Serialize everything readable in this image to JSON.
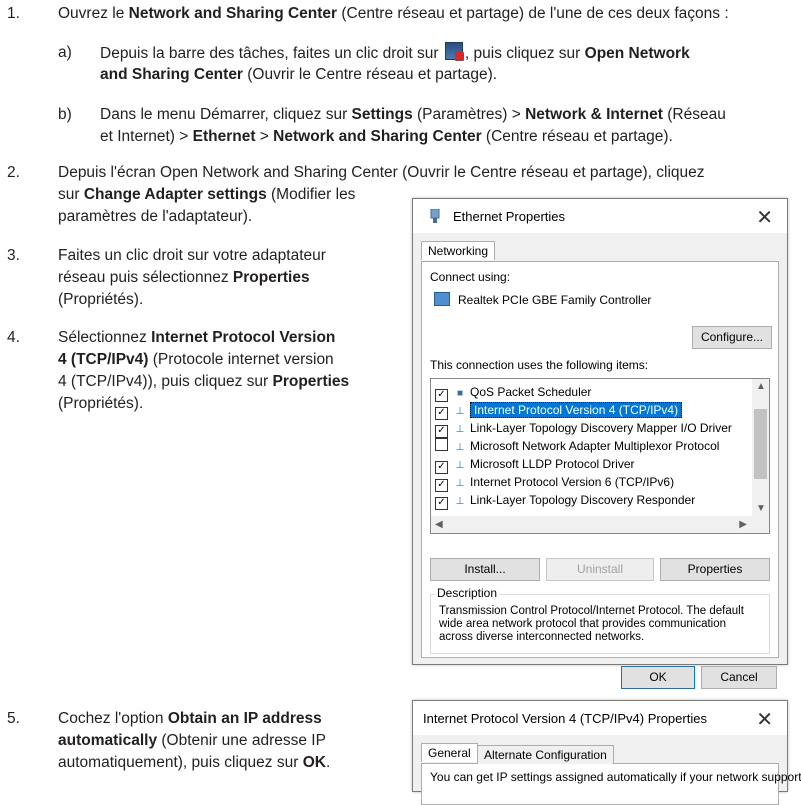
{
  "steps": {
    "s1": {
      "num": "1.",
      "t1": "Ouvrez le ",
      "b1": "Network and Sharing Center",
      "t2": " (Centre réseau et partage) de l'une de ces deux façons :",
      "a": {
        "label": "a)",
        "t1": "Depuis la barre des tâches, faites un clic droit sur ",
        "t2": ", puis cliquez sur ",
        "b1": "Open Network",
        "b2": "and Sharing Center",
        "t3": " (Ouvrir le Centre réseau et partage)."
      },
      "b": {
        "label": "b)",
        "t1": "Dans le menu Démarrer, cliquez sur ",
        "b1": "Settings",
        "t2": " (Paramètres) > ",
        "b2": "Network & Internet",
        "t3": " (Réseau",
        "t4": "et Internet) > ",
        "b3": "Ethernet",
        "t5": " > ",
        "b4": "Network and Sharing Center",
        "t6": " (Centre réseau et partage)."
      }
    },
    "s2": {
      "num": "2.",
      "l1": "Depuis l'écran Open Network and Sharing Center (Ouvrir le Centre réseau et partage), cliquez",
      "t1": "sur ",
      "b1": "Change Adapter settings",
      "t2": " (Modifier les",
      "l3": "paramètres de l'adaptateur)."
    },
    "s3": {
      "num": "3.",
      "l1": "Faites un clic droit sur votre adaptateur",
      "t1": "réseau puis sélectionnez ",
      "b1": "Properties",
      "l3": "(Propriétés)."
    },
    "s4": {
      "num": "4.",
      "t1": "Sélectionnez ",
      "b1": "Internet Protocol Version",
      "b2": "4 (TCP/IPv4)",
      "t2": " (Protocole internet version",
      "t3": "4 (TCP/IPv4)), puis cliquez sur ",
      "b3": "Properties",
      "l4": "(Propriétés)."
    },
    "s5": {
      "num": "5.",
      "t1": "Cochez l'option ",
      "b1": "Obtain an IP address",
      "b2": "automatically",
      "t2": " (Obtenir une adresse IP",
      "t3": "automatiquement), puis cliquez sur ",
      "b3": "OK",
      "t4": "."
    }
  },
  "eth_dialog": {
    "title": "Ethernet Properties",
    "close": "✕",
    "tab": "Networking",
    "connect_using": "Connect using:",
    "adapter": "Realtek PCIe GBE Family Controller",
    "configure": "Configure...",
    "items_label": "This connection uses the following items:",
    "items": [
      {
        "label": "QoS Packet Scheduler",
        "checked": true,
        "selected": false
      },
      {
        "label": "Internet Protocol Version 4 (TCP/IPv4)",
        "checked": true,
        "selected": true
      },
      {
        "label": "Link-Layer Topology Discovery Mapper I/O Driver",
        "checked": true,
        "selected": false
      },
      {
        "label": "Microsoft Network Adapter Multiplexor Protocol",
        "checked": false,
        "selected": false
      },
      {
        "label": "Microsoft LLDP Protocol Driver",
        "checked": true,
        "selected": false
      },
      {
        "label": "Internet Protocol Version 6 (TCP/IPv6)",
        "checked": true,
        "selected": false
      },
      {
        "label": "Link-Layer Topology Discovery Responder",
        "checked": true,
        "selected": false
      }
    ],
    "install": "Install...",
    "uninstall": "Uninstall",
    "properties": "Properties",
    "description_label": "Description",
    "description_1": "Transmission Control Protocol/Internet Protocol. The default",
    "description_2": "wide area network protocol that provides communication",
    "description_3": "across diverse interconnected networks.",
    "ok": "OK",
    "cancel": "Cancel"
  },
  "ipv4_dialog": {
    "title": "Internet Protocol Version 4 (TCP/IPv4) Properties",
    "close": "✕",
    "tab_general": "General",
    "tab_alternate": "Alternate Configuration",
    "partial_text": "You can get IP settings assigned automatically if your network supports"
  }
}
